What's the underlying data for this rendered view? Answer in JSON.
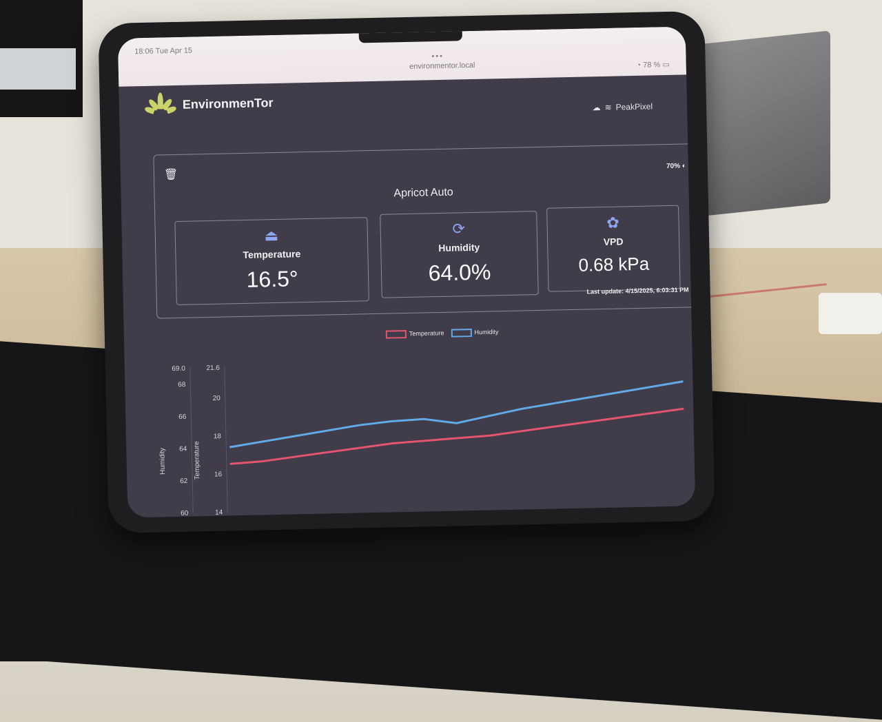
{
  "statusbar": {
    "time": "18:06   Tue Apr 15",
    "url": "environmentor.local",
    "dots": "•••",
    "battery": "78 %"
  },
  "app": {
    "name": "EnvironmenTor"
  },
  "connection": {
    "network": "PeakPixel"
  },
  "device": {
    "battery": "70%",
    "title": "Apricot Auto",
    "last_update": "Last update: 4/15/2025, 6:03:31 PM"
  },
  "metrics": [
    {
      "label": "Temperature",
      "value": "16.5°",
      "icon": "flask-icon"
    },
    {
      "label": "Humidity",
      "value": "64.0%",
      "icon": "humidity-icon"
    },
    {
      "label": "VPD",
      "value": "0.68 kPa",
      "icon": "plant-icon"
    }
  ],
  "colors": {
    "temperature": "#e5556f",
    "humidity": "#62a9e8",
    "accent": "#8fa6f3"
  },
  "chart_data": {
    "type": "line",
    "legend": [
      "Temperature",
      "Humidity"
    ],
    "axes": {
      "humidity": {
        "label": "Humidity",
        "ticks": [
          "69.0",
          "68",
          "66",
          "64",
          "62",
          "60"
        ],
        "range": [
          60,
          69
        ]
      },
      "temperature": {
        "label": "Temperature",
        "ticks": [
          "21.6",
          "20",
          "18",
          "16",
          "14"
        ],
        "range": [
          14,
          21.6
        ]
      }
    },
    "series": [
      {
        "name": "Temperature",
        "axis": "temperature",
        "values": [
          16.5,
          16.6,
          16.8,
          17.0,
          17.2,
          17.4,
          17.5,
          17.6,
          17.7,
          17.9,
          18.1,
          18.3,
          18.5,
          18.7,
          18.9
        ]
      },
      {
        "name": "Humidity",
        "axis": "humidity",
        "values": [
          64.0,
          64.3,
          64.6,
          64.9,
          65.2,
          65.4,
          65.5,
          65.2,
          65.6,
          66.0,
          66.3,
          66.6,
          66.9,
          67.2,
          67.5
        ]
      }
    ]
  }
}
